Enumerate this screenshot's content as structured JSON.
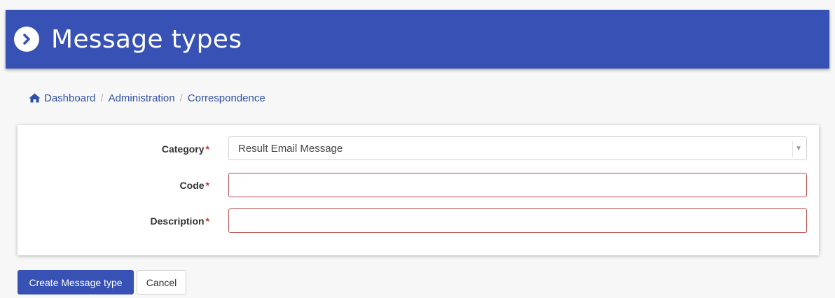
{
  "header": {
    "title": "Message types",
    "icon": "chevron-right-circle-icon",
    "background": "#3751b4"
  },
  "breadcrumb": {
    "home_icon": "home-icon",
    "items": [
      "Dashboard",
      "Administration",
      "Correspondence"
    ],
    "separator": "/"
  },
  "form": {
    "category": {
      "label": "Category",
      "required_marker": "*",
      "value": "Result Email Message"
    },
    "code": {
      "label": "Code",
      "required_marker": "*",
      "value": ""
    },
    "description": {
      "label": "Description",
      "required_marker": "*",
      "value": ""
    }
  },
  "actions": {
    "create_label": "Create Message type",
    "cancel_label": "Cancel"
  },
  "colors": {
    "primary": "#3751b4",
    "link": "#2f4fa8",
    "required": "#d2322d",
    "error_border": "#b94a48"
  }
}
